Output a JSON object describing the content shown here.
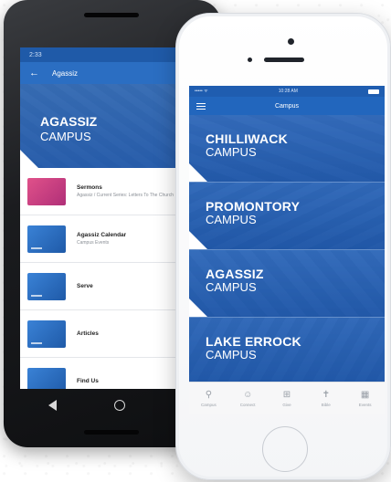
{
  "android": {
    "status": {
      "time": "2:33",
      "icons": "▾ ◢ ▮"
    },
    "appbar": {
      "back_icon": "arrow-left-icon",
      "title": "Agassiz",
      "action_icon": "share-icon"
    },
    "hero": {
      "line1": "AGASSIZ",
      "line2": "CAMPUS"
    },
    "list": [
      {
        "title": "Sermons",
        "subtitle": "Agassiz / Current Series: Letters To The Church",
        "thumb": "pink"
      },
      {
        "title": "Agassiz Calendar",
        "subtitle": "Campus Events",
        "thumb": "blue"
      },
      {
        "title": "Serve",
        "subtitle": "",
        "thumb": "blue"
      },
      {
        "title": "Articles",
        "subtitle": "",
        "thumb": "blue"
      },
      {
        "title": "Find Us",
        "subtitle": "",
        "thumb": "blue"
      }
    ],
    "nav_icons": [
      "back-triangle-icon",
      "home-circle-icon",
      "recents-square-icon"
    ]
  },
  "iphone": {
    "status": {
      "carrier": "••••• ᯤ",
      "time": "10:28 AM"
    },
    "navbar": {
      "menu_icon": "hamburger-icon",
      "title": "Campus"
    },
    "campuses": [
      {
        "line1": "CHILLIWACK",
        "line2": "CAMPUS"
      },
      {
        "line1": "PROMONTORY",
        "line2": "CAMPUS"
      },
      {
        "line1": "AGASSIZ",
        "line2": "CAMPUS"
      },
      {
        "line1": "LAKE ERROCK",
        "line2": "CAMPUS"
      }
    ],
    "tabs": [
      {
        "label": "Campus",
        "icon": "location-pin-icon"
      },
      {
        "label": "Connect",
        "icon": "people-icon"
      },
      {
        "label": "Give",
        "icon": "gift-icon"
      },
      {
        "label": "Bible",
        "icon": "bible-icon"
      },
      {
        "label": "Events",
        "icon": "calendar-icon"
      }
    ]
  },
  "colors": {
    "brand_blue": "#2266bd",
    "dark_blue": "#1b56a8",
    "sermon_pink": "#d9478a"
  }
}
